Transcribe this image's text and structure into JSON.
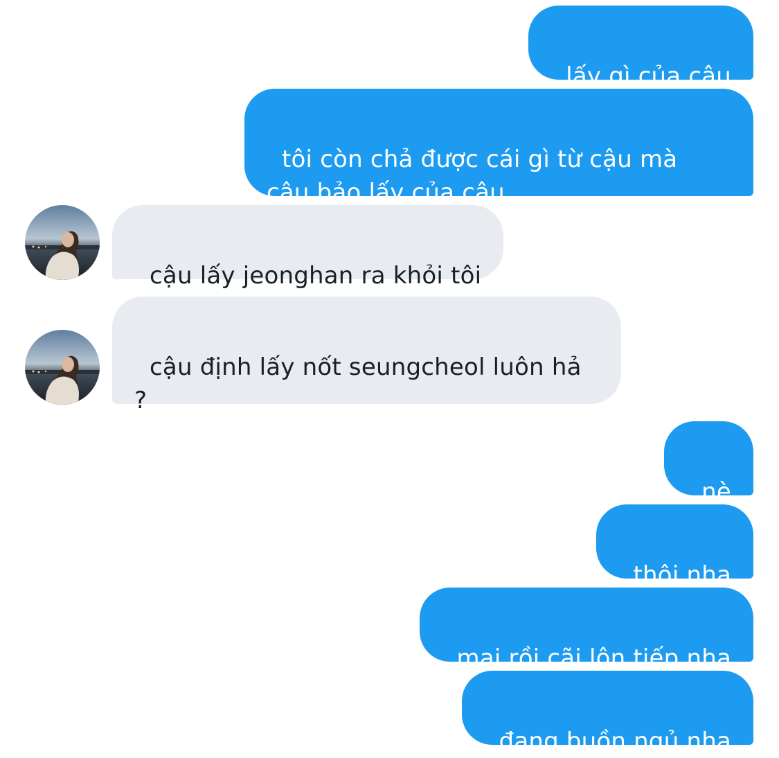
{
  "conversation": {
    "messages": [
      {
        "sender": "me",
        "text": "lấy gì của cậu"
      },
      {
        "sender": "me",
        "text": "tôi còn chả được cái gì từ cậu mà\ncậu bảo lấy của cậu"
      },
      {
        "sender": "them",
        "text": "cậu lấy jeonghan ra khỏi tôi"
      },
      {
        "sender": "them",
        "text": "cậu định lấy nốt seungcheol luôn hả\n?"
      },
      {
        "sender": "me",
        "text": "nè"
      },
      {
        "sender": "me",
        "text": "thôi nha"
      },
      {
        "sender": "me",
        "text": "mai rồi cãi lộn tiếp nha"
      },
      {
        "sender": "me",
        "text": "đang buồn ngủ nha"
      }
    ]
  },
  "colors": {
    "outgoing_bubble": "#1d9bf0",
    "incoming_bubble": "#e8ecf0",
    "outgoing_text": "#ffffff",
    "incoming_text": "#1a1f24"
  },
  "icons": {
    "contact_avatar": "contact-avatar-photo"
  }
}
